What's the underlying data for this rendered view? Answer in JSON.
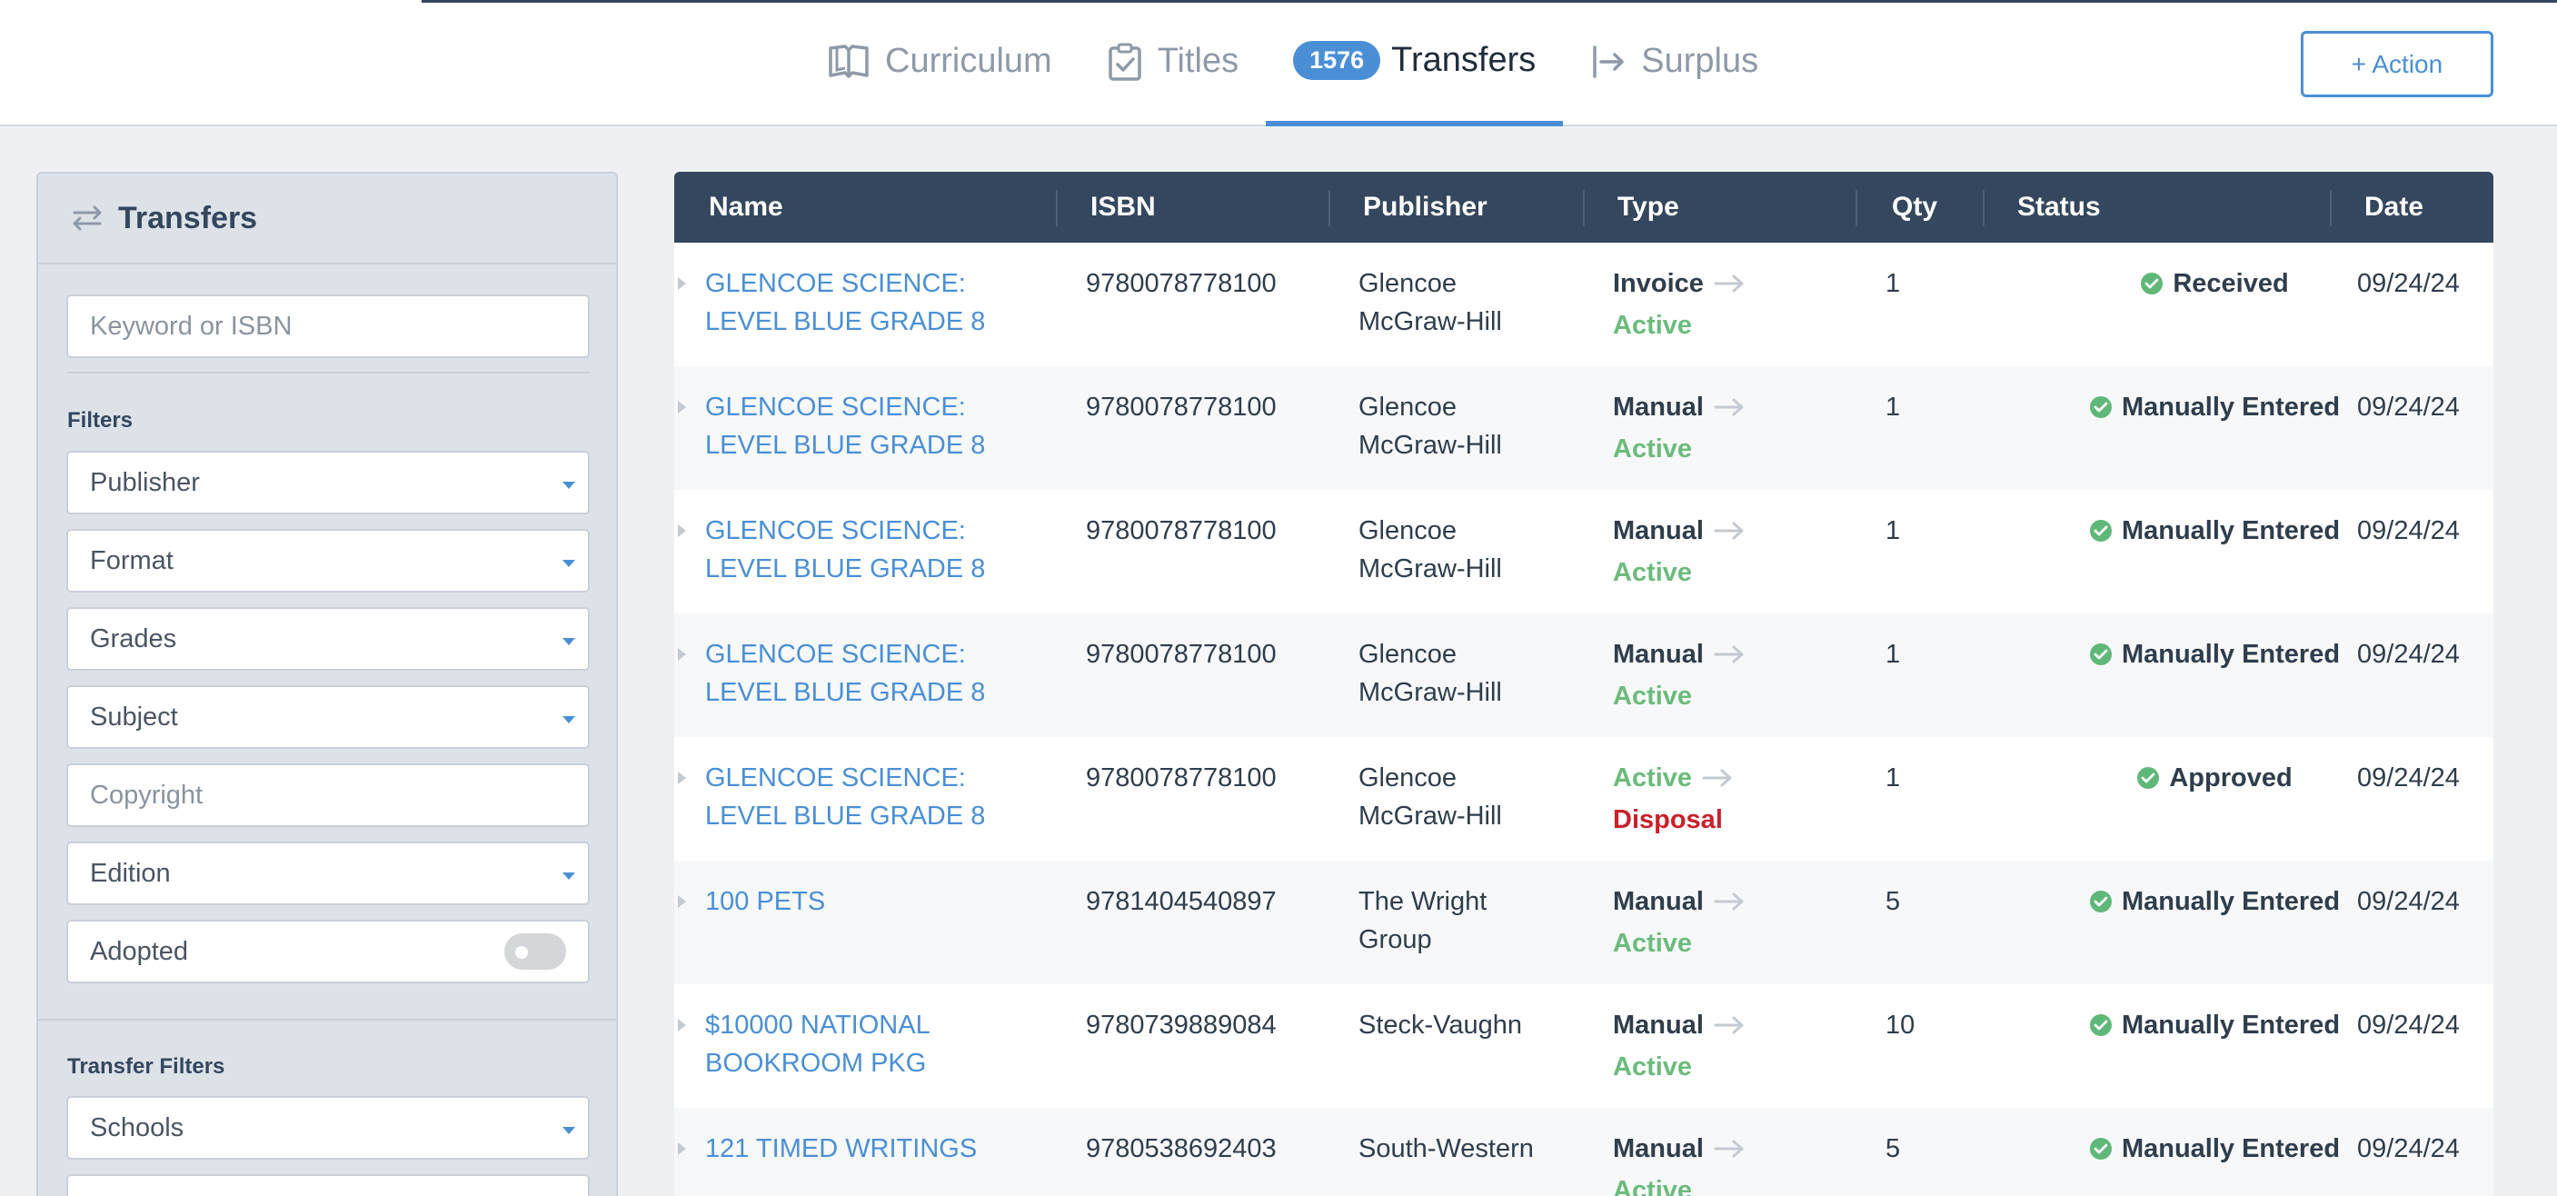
{
  "nav": {
    "tabs": [
      {
        "label": "Curriculum",
        "icon": "book-open-icon"
      },
      {
        "label": "Titles",
        "icon": "clipboard-check-icon"
      },
      {
        "label": "Transfers",
        "icon": "",
        "badge": "1576",
        "active": true
      },
      {
        "label": "Surplus",
        "icon": "exit-arrow-icon"
      }
    ],
    "action_label": "+ Action"
  },
  "sidebar": {
    "title": "Transfers",
    "search_placeholder": "Keyword or ISBN",
    "filters_label": "Filters",
    "filters": [
      "Publisher",
      "Format",
      "Grades",
      "Subject",
      "Copyright",
      "Edition",
      "Adopted"
    ],
    "transfer_filters_label": "Transfer Filters",
    "transfer_filters": [
      "Schools"
    ]
  },
  "table": {
    "columns": [
      "Name",
      "ISBN",
      "Publisher",
      "Type",
      "Qty",
      "Status",
      "Date"
    ],
    "rows": [
      {
        "name_l1": "GLENCOE SCIENCE:",
        "name_l2": "LEVEL BLUE GRADE 8",
        "isbn": "9780078778100",
        "pub_l1": "Glencoe",
        "pub_l2": "McGraw-Hill",
        "type1": "Invoice",
        "type2": "Active",
        "qty": "1",
        "status": "Received",
        "date": "09/24/24"
      },
      {
        "name_l1": "GLENCOE SCIENCE:",
        "name_l2": "LEVEL BLUE GRADE 8",
        "isbn": "9780078778100",
        "pub_l1": "Glencoe",
        "pub_l2": "McGraw-Hill",
        "type1": "Manual",
        "type2": "Active",
        "qty": "1",
        "status": "Manually Entered",
        "date": "09/24/24"
      },
      {
        "name_l1": "GLENCOE SCIENCE:",
        "name_l2": "LEVEL BLUE GRADE 8",
        "isbn": "9780078778100",
        "pub_l1": "Glencoe",
        "pub_l2": "McGraw-Hill",
        "type1": "Manual",
        "type2": "Active",
        "qty": "1",
        "status": "Manually Entered",
        "date": "09/24/24"
      },
      {
        "name_l1": "GLENCOE SCIENCE:",
        "name_l2": "LEVEL BLUE GRADE 8",
        "isbn": "9780078778100",
        "pub_l1": "Glencoe",
        "pub_l2": "McGraw-Hill",
        "type1": "Manual",
        "type2": "Active",
        "qty": "1",
        "status": "Manually Entered",
        "date": "09/24/24"
      },
      {
        "name_l1": "GLENCOE SCIENCE:",
        "name_l2": "LEVEL BLUE GRADE 8",
        "isbn": "9780078778100",
        "pub_l1": "Glencoe",
        "pub_l2": "McGraw-Hill",
        "type1": "Active",
        "type2": "Disposal",
        "qty": "1",
        "status": "Approved",
        "date": "09/24/24"
      },
      {
        "name_l1": "100 PETS",
        "name_l2": "",
        "isbn": "9781404540897",
        "pub_l1": "The Wright",
        "pub_l2": "Group",
        "type1": "Manual",
        "type2": "Active",
        "qty": "5",
        "status": "Manually Entered",
        "date": "09/24/24"
      },
      {
        "name_l1": "$10000 NATIONAL",
        "name_l2": "BOOKROOM PKG",
        "isbn": "9780739889084",
        "pub_l1": "Steck-Vaughn",
        "pub_l2": "",
        "type1": "Manual",
        "type2": "Active",
        "qty": "10",
        "status": "Manually Entered",
        "date": "09/24/24"
      },
      {
        "name_l1": "121 TIMED WRITINGS",
        "name_l2": "",
        "isbn": "9780538692403",
        "pub_l1": "South-Western",
        "pub_l2": "",
        "type1": "Manual",
        "type2": "Active",
        "qty": "5",
        "status": "Manually Entered",
        "date": "09/24/24"
      }
    ]
  },
  "colors": {
    "accent": "#4a8fd6",
    "header": "#34475e",
    "active_green": "#6cbb7c",
    "disposal_red": "#c8212b",
    "status_green": "#5fb878"
  }
}
